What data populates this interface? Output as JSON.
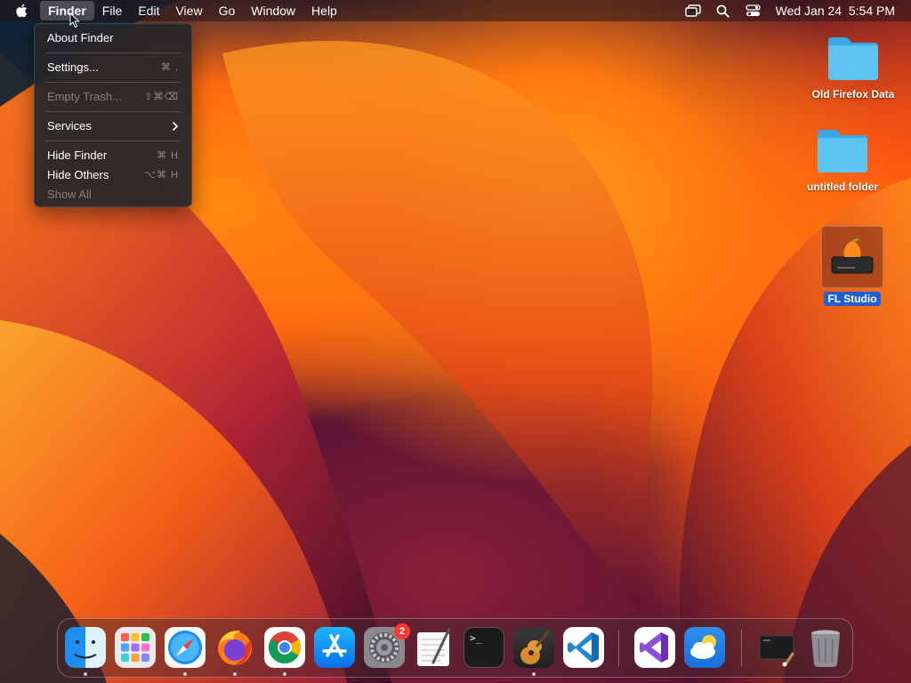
{
  "menubar": {
    "apple_icon": "apple-logo-icon",
    "items": [
      {
        "label": "Finder",
        "active": true
      },
      {
        "label": "File"
      },
      {
        "label": "Edit"
      },
      {
        "label": "View"
      },
      {
        "label": "Go"
      },
      {
        "label": "Window"
      },
      {
        "label": "Help"
      }
    ],
    "status_icons": [
      "screen-mirroring-icon",
      "search-icon",
      "control-center-icon"
    ],
    "clock": "Wed Jan 24  5:54 PM"
  },
  "finder_menu": {
    "about": "About Finder",
    "settings": {
      "label": "Settings...",
      "shortcut": "⌘ ,"
    },
    "empty_trash": {
      "label": "Empty Trash...",
      "shortcut": "⇧⌘⌫"
    },
    "services": {
      "label": "Services"
    },
    "hide_finder": {
      "label": "Hide Finder",
      "shortcut": "⌘ H"
    },
    "hide_others": {
      "label": "Hide Others",
      "shortcut": "⌥⌘ H"
    },
    "show_all": {
      "label": "Show All"
    }
  },
  "desktop": {
    "icons": [
      {
        "label": "Old Firefox Data",
        "type": "folder"
      },
      {
        "label": "untitled folder",
        "type": "folder"
      },
      {
        "label": "FL Studio",
        "type": "disk-image",
        "selected": true
      }
    ]
  },
  "dock": {
    "apps": [
      {
        "name": "Finder",
        "icon": "finder-icon",
        "running": true
      },
      {
        "name": "Launchpad",
        "icon": "launchpad-icon",
        "running": false
      },
      {
        "name": "Safari",
        "icon": "safari-icon",
        "running": true
      },
      {
        "name": "Firefox",
        "icon": "firefox-icon",
        "running": true
      },
      {
        "name": "Chrome",
        "icon": "chrome-icon",
        "running": true
      },
      {
        "name": "App Store",
        "icon": "app-store-icon",
        "running": false
      },
      {
        "name": "System Settings",
        "icon": "system-settings-icon",
        "running": false,
        "badge": "2"
      },
      {
        "name": "TextEdit",
        "icon": "textedit-icon",
        "running": false
      },
      {
        "name": "Terminal",
        "icon": "terminal-icon",
        "running": false
      },
      {
        "name": "GarageBand",
        "icon": "garageband-icon",
        "running": true
      },
      {
        "name": "VS Code",
        "icon": "vscode-icon",
        "running": false
      },
      {
        "name": "Visual Studio",
        "icon": "visual-studio-icon",
        "running": false
      },
      {
        "name": "Weather",
        "icon": "weather-icon",
        "running": false
      },
      {
        "name": "Screenshot Stack",
        "icon": "stack-icon",
        "running": false
      },
      {
        "name": "Trash",
        "icon": "trash-icon",
        "running": false
      }
    ],
    "terminal_prompt": ">_"
  },
  "colors": {
    "selection_blue": "#1f5fd1",
    "badge_red": "#ff3b30",
    "folder_blue": "#5ec3f2"
  }
}
